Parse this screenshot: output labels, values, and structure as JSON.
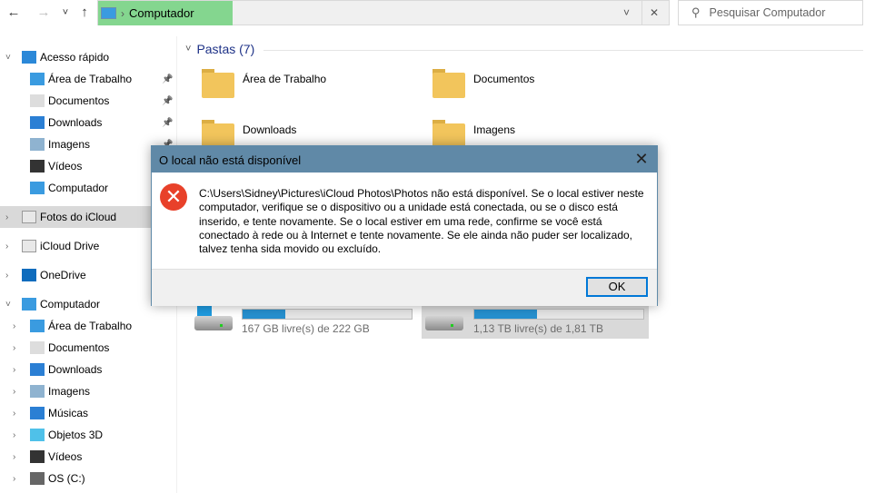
{
  "toolbar": {
    "back": "←",
    "forward": "→",
    "recent": "˅",
    "up": "↑"
  },
  "address": {
    "crumb": "Computador",
    "sep": "›",
    "dropdown": "˅",
    "clear": "✕"
  },
  "search": {
    "placeholder": "Pesquisar Computador",
    "icon": "search-icon"
  },
  "sidebar": {
    "items": [
      {
        "label": "Acesso rápido",
        "level": 0,
        "expanded": true,
        "icon": "star-icon"
      },
      {
        "label": "Área de Trabalho",
        "level": 1,
        "pinned": true,
        "icon": "desktop-icon"
      },
      {
        "label": "Documentos",
        "level": 1,
        "pinned": true,
        "icon": "documents-icon"
      },
      {
        "label": "Downloads",
        "level": 1,
        "pinned": true,
        "icon": "download-icon"
      },
      {
        "label": "Imagens",
        "level": 1,
        "pinned": true,
        "icon": "pictures-icon"
      },
      {
        "label": "Vídeos",
        "level": 1,
        "icon": "videos-icon"
      },
      {
        "label": "Computador",
        "level": 1,
        "icon": "computer-icon"
      },
      {
        "label": "Fotos do iCloud",
        "level": 0,
        "selected": true,
        "icon": "icloud-photos-icon"
      },
      {
        "label": "iCloud Drive",
        "level": 0,
        "icon": "icloud-drive-icon"
      },
      {
        "label": "OneDrive",
        "level": 0,
        "icon": "onedrive-icon"
      },
      {
        "label": "Computador",
        "level": 0,
        "expanded": true,
        "icon": "computer-icon"
      },
      {
        "label": "Área de Trabalho",
        "level": 1,
        "icon": "desktop-icon"
      },
      {
        "label": "Documentos",
        "level": 1,
        "icon": "documents-icon"
      },
      {
        "label": "Downloads",
        "level": 1,
        "icon": "download-icon"
      },
      {
        "label": "Imagens",
        "level": 1,
        "icon": "pictures-icon"
      },
      {
        "label": "Músicas",
        "level": 1,
        "icon": "music-icon"
      },
      {
        "label": "Objetos 3D",
        "level": 1,
        "icon": "3d-objects-icon"
      },
      {
        "label": "Vídeos",
        "level": 1,
        "icon": "videos-icon"
      },
      {
        "label": "OS (C:)",
        "level": 1,
        "icon": "drive-icon"
      }
    ]
  },
  "main": {
    "group_title": "Pastas (7)",
    "folders": [
      "Área de Trabalho",
      "Documentos",
      "Downloads",
      "Imagens"
    ],
    "drives": [
      {
        "free_label": "167 GB livre(s) de 222 GB",
        "used_percent": 25
      },
      {
        "free_label": "1,13 TB livre(s) de 1,81 TB",
        "used_percent": 37
      }
    ]
  },
  "dialog": {
    "title": "O local não está disponível",
    "close": "✕",
    "icon": "error-icon",
    "message": "C:\\Users\\Sidney\\Pictures\\iCloud Photos\\Photos não está disponível. Se o local estiver neste computador, verifique se o dispositivo ou a unidade está conectada, ou se o disco está inserido, e tente novamente. Se o local estiver em uma rede, confirme se você está conectado à rede ou à Internet e tente novamente. Se ele ainda não puder ser localizado, talvez tenha sida movido ou excluído.",
    "ok": "OK"
  },
  "colors": {
    "accent": "#0078d7",
    "dialog_title_bg": "#6089a7",
    "breadcrumb_highlight": "#84d68f",
    "error": "#e8412a",
    "drive_bar": "#2690cf"
  }
}
